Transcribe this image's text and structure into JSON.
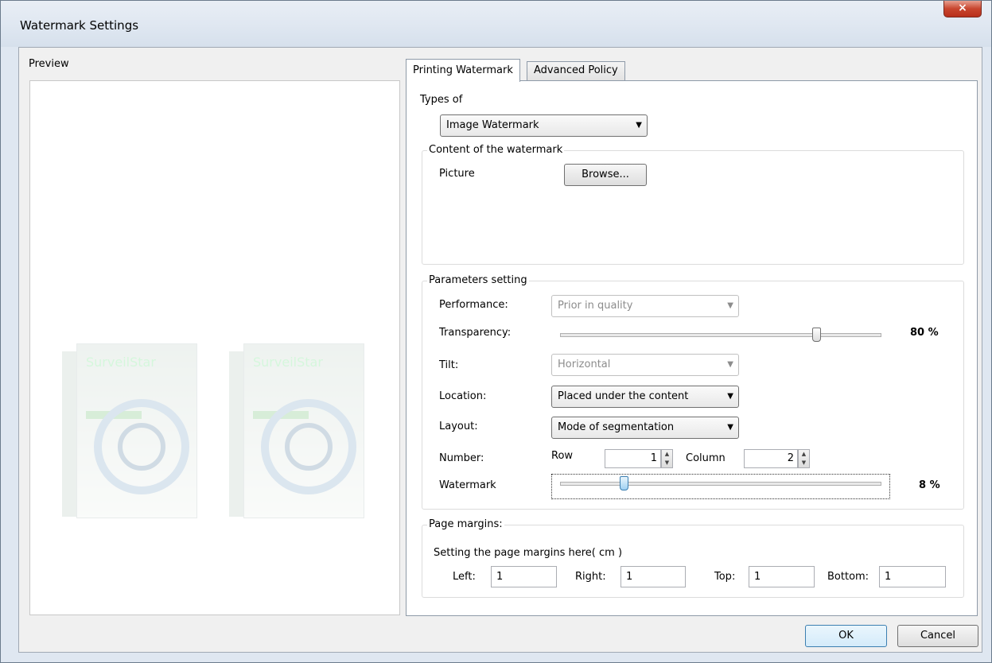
{
  "window": {
    "title": "Watermark Settings",
    "close_glyph": "×"
  },
  "preview": {
    "label": "Preview",
    "brand_text": "SurveilStar"
  },
  "tabs": [
    {
      "label": "Printing Watermark",
      "active": true
    },
    {
      "label": "Advanced Policy",
      "active": false
    }
  ],
  "types": {
    "label": "Types of",
    "value": "Image Watermark"
  },
  "content": {
    "group_label": "Content of the watermark",
    "picture_label": "Picture",
    "browse_label": "Browse..."
  },
  "params": {
    "group_label": "Parameters setting",
    "performance": {
      "label": "Performance:",
      "value": "Prior in quality"
    },
    "transparency": {
      "label": "Transparency:",
      "value": 80,
      "value_text": "80 %"
    },
    "tilt": {
      "label": "Tilt:",
      "value": "Horizontal"
    },
    "location": {
      "label": "Location:",
      "value": "Placed under the content"
    },
    "layout": {
      "label": "Layout:",
      "value": "Mode of segmentation"
    },
    "number": {
      "label": "Number:",
      "row_label": "Row",
      "row_value": "1",
      "column_label": "Column",
      "column_value": "2"
    },
    "watermark": {
      "label": "Watermark",
      "value": 8,
      "value_text": "8 %"
    }
  },
  "margins": {
    "group_label": "Page margins:",
    "hint": "Setting the page margins here( cm )",
    "left": {
      "label": "Left:",
      "value": "1"
    },
    "right": {
      "label": "Right:",
      "value": "1"
    },
    "top": {
      "label": "Top:",
      "value": "1"
    },
    "bottom": {
      "label": "Bottom:",
      "value": "1"
    }
  },
  "footer": {
    "ok_label": "OK",
    "cancel_label": "Cancel"
  },
  "icons": {
    "dropdown": "▼",
    "spin_up": "▲",
    "spin_down": "▼"
  },
  "colors": {
    "title_bar": "#dfe7f1",
    "close_button": "#c8452e",
    "panel_bg": "#f0f0f0",
    "default_button_border": "#3c7fb1"
  }
}
